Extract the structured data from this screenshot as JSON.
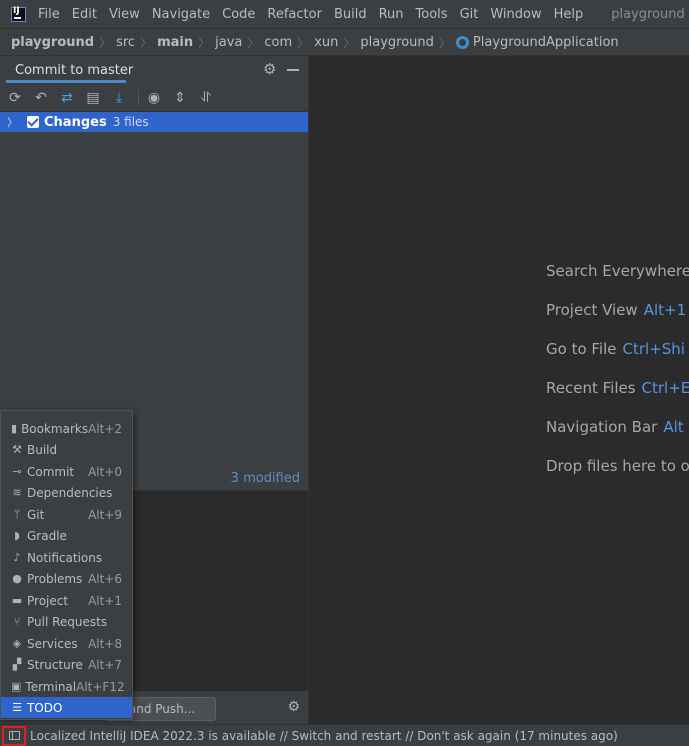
{
  "menubar": {
    "items": [
      "File",
      "Edit",
      "View",
      "Navigate",
      "Code",
      "Refactor",
      "Build",
      "Run",
      "Tools",
      "Git",
      "Window",
      "Help"
    ],
    "project_title": "playground"
  },
  "breadcrumb": {
    "items": [
      "playground",
      "src",
      "main",
      "java",
      "com",
      "xun",
      "playground"
    ],
    "file": "PlaygroundApplication"
  },
  "commit_panel": {
    "title": "Commit to master",
    "changes_label": "Changes",
    "changes_count": "3 files",
    "modified": "3 modified",
    "commit_push_label": "it and Push..."
  },
  "editor_hints": [
    {
      "text": "Search Everywhere",
      "key": ""
    },
    {
      "text": "Project View",
      "key": "Alt+1"
    },
    {
      "text": "Go to File",
      "key": "Ctrl+Shi"
    },
    {
      "text": "Recent Files",
      "key": "Ctrl+E"
    },
    {
      "text": "Navigation Bar",
      "key": "Alt"
    },
    {
      "text": "Drop files here to o",
      "key": ""
    }
  ],
  "tool_windows": [
    {
      "label": "Bookmarks",
      "shortcut": "Alt+2",
      "icon": "bookmark-icon"
    },
    {
      "label": "Build",
      "shortcut": "",
      "icon": "hammer-icon"
    },
    {
      "label": "Commit",
      "shortcut": "Alt+0",
      "icon": "commit-icon"
    },
    {
      "label": "Dependencies",
      "shortcut": "",
      "icon": "layers-icon"
    },
    {
      "label": "Git",
      "shortcut": "Alt+9",
      "icon": "branch-icon"
    },
    {
      "label": "Gradle",
      "shortcut": "",
      "icon": "elephant-icon"
    },
    {
      "label": "Notifications",
      "shortcut": "",
      "icon": "bell-icon"
    },
    {
      "label": "Problems",
      "shortcut": "Alt+6",
      "icon": "warning-icon"
    },
    {
      "label": "Project",
      "shortcut": "Alt+1",
      "icon": "folder-icon"
    },
    {
      "label": "Pull Requests",
      "shortcut": "",
      "icon": "pull-request-icon"
    },
    {
      "label": "Services",
      "shortcut": "Alt+8",
      "icon": "services-icon"
    },
    {
      "label": "Structure",
      "shortcut": "Alt+7",
      "icon": "structure-icon"
    },
    {
      "label": "Terminal",
      "shortcut": "Alt+F12",
      "icon": "terminal-icon"
    },
    {
      "label": "TODO",
      "shortcut": "",
      "icon": "list-icon"
    }
  ],
  "statusbar": {
    "message": "Localized IntelliJ IDEA 2022.3 is available // Switch and restart // Don't ask again (17 minutes ago)"
  },
  "colors": {
    "accent": "#2f65ca",
    "link": "#5894e0",
    "highlight_border": "#e02020"
  }
}
